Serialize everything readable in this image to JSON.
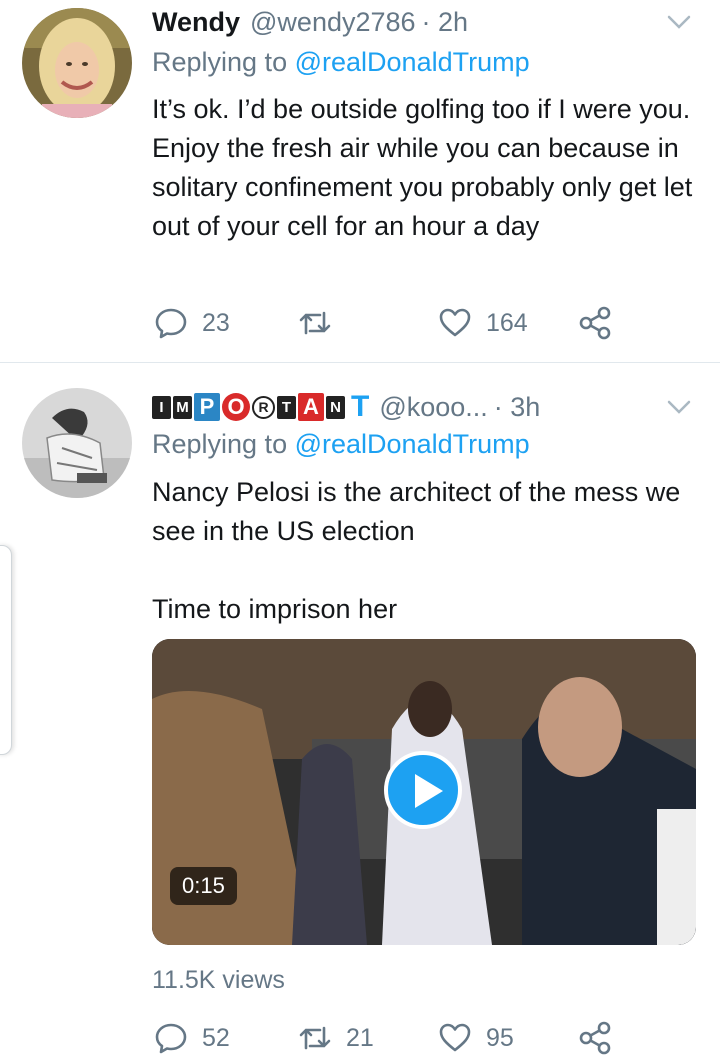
{
  "tweets": [
    {
      "display_name": "Wendy",
      "handle": "@wendy2786",
      "time": "· 2h",
      "reply_prefix": "Replying to",
      "reply_to": "@realDonaldTrump",
      "text": "It’s ok.  I’d be outside golfing too if I were you.  Enjoy the fresh air while you can because in solitary confinement you probably only get let out of your cell for an hour a day",
      "replies": "23",
      "retweets": "",
      "likes": "164"
    },
    {
      "display_name_letters": [
        "I",
        "M",
        "P",
        "O",
        "R",
        "T",
        "A",
        "N",
        "T"
      ],
      "handle": "@kooo...",
      "time": "· 3h",
      "reply_prefix": "Replying to",
      "reply_to": "@realDonaldTrump",
      "text": "Nancy Pelosi is the architect of the mess we see in the US election\n\nTime to imprison her",
      "video_duration": "0:15",
      "views": "11.5K views",
      "replies": "52",
      "retweets": "21",
      "likes": "95"
    }
  ],
  "icons": {
    "reply": "speech-bubble-icon",
    "retweet": "retweet-icon",
    "like": "heart-icon",
    "share": "share-icon",
    "menu": "chevron-down-icon",
    "play": "play-icon"
  },
  "colors": {
    "accent": "#1da1f2",
    "secondary_text": "#657786",
    "primary_text": "#14171a",
    "divider": "#e1e8ed"
  }
}
